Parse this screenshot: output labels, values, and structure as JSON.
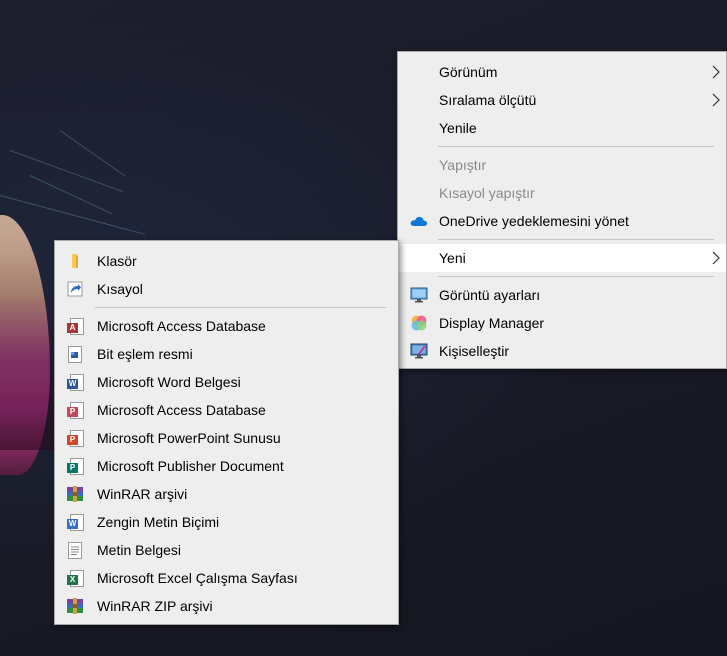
{
  "context_menu": {
    "items": [
      {
        "label": "Görünüm",
        "icon": "none",
        "submenu": true,
        "disabled": false
      },
      {
        "label": "Sıralama ölçütü",
        "icon": "none",
        "submenu": true,
        "disabled": false
      },
      {
        "label": "Yenile",
        "icon": "none",
        "submenu": false,
        "disabled": false
      },
      {
        "label": "Yapıştır",
        "icon": "none",
        "submenu": false,
        "disabled": true
      },
      {
        "label": "Kısayol yapıştır",
        "icon": "none",
        "submenu": false,
        "disabled": true
      },
      {
        "label": "OneDrive yedeklemesini yönet",
        "icon": "onedrive-cloud-icon",
        "submenu": false,
        "disabled": false
      },
      {
        "label": "Yeni",
        "icon": "none",
        "submenu": true,
        "disabled": false,
        "highlighted": true
      },
      {
        "label": "Görüntü ayarları",
        "icon": "display-settings-icon",
        "submenu": false,
        "disabled": false
      },
      {
        "label": "Display Manager",
        "icon": "display-manager-icon",
        "submenu": false,
        "disabled": false
      },
      {
        "label": "Kişiselleştir",
        "icon": "personalize-icon",
        "submenu": false,
        "disabled": false
      }
    ]
  },
  "new_submenu": {
    "items": [
      {
        "label": "Klasör",
        "icon": "folder-icon"
      },
      {
        "label": "Kısayol",
        "icon": "shortcut-icon"
      },
      {
        "label": "Microsoft Access Database",
        "icon": "access-icon"
      },
      {
        "label": "Bit eşlem resmi",
        "icon": "bitmap-icon"
      },
      {
        "label": "Microsoft Word Belgesi",
        "icon": "word-icon"
      },
      {
        "label": "Microsoft Access Database",
        "icon": "access-icon"
      },
      {
        "label": "Microsoft PowerPoint Sunusu",
        "icon": "powerpoint-icon"
      },
      {
        "label": "Microsoft Publisher Document",
        "icon": "publisher-icon"
      },
      {
        "label": "WinRAR arşivi",
        "icon": "winrar-icon"
      },
      {
        "label": "Zengin Metin Biçimi",
        "icon": "wordpad-icon"
      },
      {
        "label": "Metin Belgesi",
        "icon": "text-document-icon"
      },
      {
        "label": "Microsoft Excel Çalışma Sayfası",
        "icon": "excel-icon"
      },
      {
        "label": "WinRAR ZIP arşivi",
        "icon": "winrar-zip-icon"
      }
    ]
  },
  "colors": {
    "menu_background": "#eeeeee",
    "highlight": "#ffffff",
    "disabled_text": "#8a8a8a",
    "access": "#a4373a",
    "word": "#2b579a",
    "powerpoint": "#d24726",
    "publisher": "#077568",
    "excel": "#217346",
    "onedrive": "#0f78d4"
  }
}
